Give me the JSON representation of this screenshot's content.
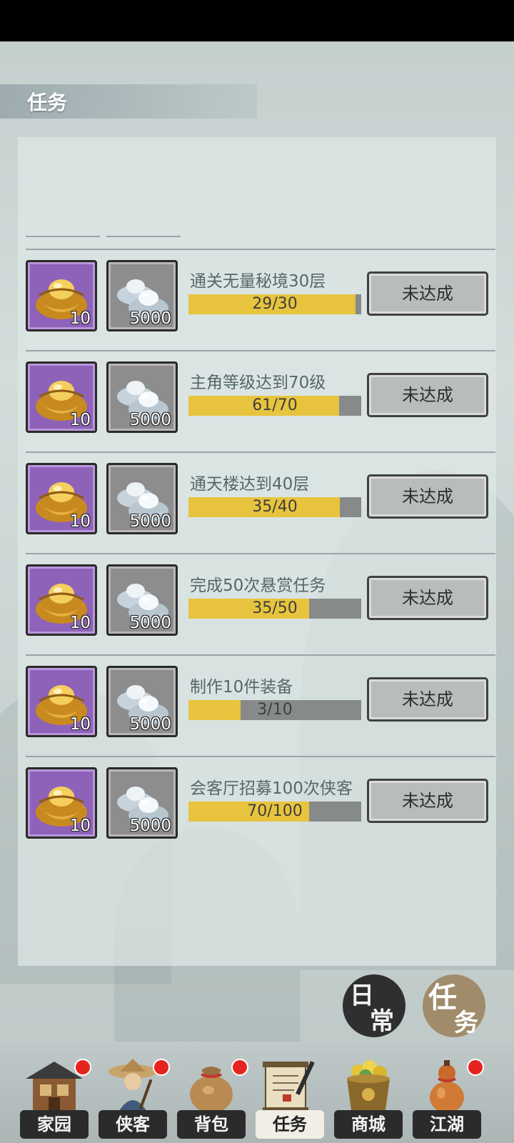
{
  "header": {
    "title": "任务"
  },
  "tasks": [
    {
      "name": "通关无量秘境30层",
      "progress_text": "29/30",
      "progress": 0.967,
      "gold_qty": "10",
      "silver_qty": "5000",
      "button": "未达成"
    },
    {
      "name": "主角等级达到70级",
      "progress_text": "61/70",
      "progress": 0.871,
      "gold_qty": "10",
      "silver_qty": "5000",
      "button": "未达成"
    },
    {
      "name": "通天楼达到40层",
      "progress_text": "35/40",
      "progress": 0.875,
      "gold_qty": "10",
      "silver_qty": "5000",
      "button": "未达成"
    },
    {
      "name": "完成50次悬赏任务",
      "progress_text": "35/50",
      "progress": 0.7,
      "gold_qty": "10",
      "silver_qty": "5000",
      "button": "未达成"
    },
    {
      "name": "制作10件装备",
      "progress_text": "3/10",
      "progress": 0.3,
      "gold_qty": "10",
      "silver_qty": "5000",
      "button": "未达成"
    },
    {
      "name": "会客厅招募100次侠客",
      "progress_text": "70/100",
      "progress": 0.7,
      "gold_qty": "10",
      "silver_qty": "5000",
      "button": "未达成"
    }
  ],
  "side_buttons": {
    "daily": {
      "char1": "日",
      "char2": "常"
    },
    "task": {
      "char1": "任",
      "char2": "务"
    }
  },
  "nav": [
    {
      "label": "家园",
      "icon": "house-icon",
      "badge": true
    },
    {
      "label": "侠客",
      "icon": "hero-icon",
      "badge": true
    },
    {
      "label": "背包",
      "icon": "bag-icon",
      "badge": true
    },
    {
      "label": "任务",
      "icon": "scroll-icon",
      "badge": false,
      "active": true
    },
    {
      "label": "商城",
      "icon": "treasure-pot-icon",
      "badge": false
    },
    {
      "label": "江湖",
      "icon": "gourd-icon",
      "badge": true
    }
  ],
  "colors": {
    "progress_fill": "#e8c43e",
    "progress_track": "#868a8a",
    "gold_frame": "#8e62b8",
    "silver_frame": "#8d8d8d",
    "badge": "#e6241f"
  }
}
